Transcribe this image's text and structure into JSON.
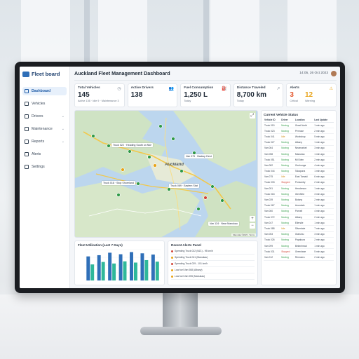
{
  "app": {
    "brand": "Fleet board",
    "title": "Auckland Fleet Management Dashboard",
    "datetime": "14:05, 26 Oct 2023"
  },
  "sidebar": {
    "items": [
      {
        "label": "Dashboard",
        "icon": "dashboard-icon",
        "active": true,
        "chevron": false
      },
      {
        "label": "Vehicles",
        "icon": "truck-icon",
        "active": false,
        "chevron": false
      },
      {
        "label": "Drivers",
        "icon": "user-icon",
        "active": false,
        "chevron": true
      },
      {
        "label": "Maintenance",
        "icon": "wrench-icon",
        "active": false,
        "chevron": true
      },
      {
        "label": "Reports",
        "icon": "report-icon",
        "active": false,
        "chevron": true
      },
      {
        "label": "Alerts",
        "icon": "bell-icon",
        "active": false,
        "chevron": false
      },
      {
        "label": "Settings",
        "icon": "gear-icon",
        "active": false,
        "chevron": false
      }
    ]
  },
  "cards": {
    "vehicles": {
      "label": "Total Vehicles",
      "value": "145",
      "sub": "Active 136 · Idle 9 · Maintenance 3"
    },
    "drivers": {
      "label": "Active Drivers",
      "value": "138"
    },
    "fuel": {
      "label": "Fuel Consumption",
      "value": "1,250 L",
      "sub": "Today"
    },
    "distance": {
      "label": "Distance Traveled",
      "value": "8,700 km",
      "sub": "Today"
    },
    "alerts": {
      "label": "Alerts",
      "critical_value": "3",
      "critical_label": "Critical",
      "warning_value": "12",
      "warning_label": "Warning"
    }
  },
  "map": {
    "city_label": "Auckland",
    "attribution": "Map data ©2023 · Terms",
    "callouts": [
      "Truck 022 · Heading South on NW",
      "Van 075 · Backup Dest",
      "Truck 018 · Stop Shoreland",
      "Truck 089 · Eastern Stat",
      "Van 124 · Near Manukau"
    ]
  },
  "utilization": {
    "title": "Fleet Utilization (Last 7 Days)"
  },
  "recent_alerts": {
    "title": "Recent Alerts Panel",
    "items": [
      {
        "text": "Speeding Truck 022 (NZ1) - 95 km/h",
        "color": "#d2463a"
      },
      {
        "text": "Speeding Truck 041 (Manukau)",
        "color": "#e8a317"
      },
      {
        "text": "Speeding Truck 029 - 101 km/h",
        "color": "#d2463a"
      },
      {
        "text": "Low fuel Van 068 (Albany)",
        "color": "#e8a317"
      },
      {
        "text": "Low fuel Van 055 (Manukau)",
        "color": "#e8a317"
      }
    ]
  },
  "status": {
    "title": "Current Vehicle Status",
    "columns": [
      "Vehicle ID",
      "Driver",
      "Location",
      "Last Update"
    ],
    "rows": [
      [
        "Truck 015",
        "Moving",
        "Great North",
        "1 min ago"
      ],
      [
        "Truck 023",
        "Moving",
        "Penrose",
        "2 min ago"
      ],
      [
        "Truck 041",
        "Idle",
        "Workshop",
        "5 min ago"
      ],
      [
        "Truck 027",
        "Moving",
        "Albany",
        "1 min ago"
      ],
      [
        "Van 064",
        "Moving",
        "Newmarket",
        "3 min ago"
      ],
      [
        "Van 058",
        "Moving",
        "Manukau",
        "1 min ago"
      ],
      [
        "Truck 051",
        "Moving",
        "Mt Eden",
        "2 min ago"
      ],
      [
        "Van 082",
        "Moving",
        "Onehunga",
        "4 min ago"
      ],
      [
        "Truck 044",
        "Moving",
        "Takapuna",
        "1 min ago"
      ],
      [
        "Van 075",
        "Idle",
        "East Tamaki",
        "6 min ago"
      ],
      [
        "Truck 033",
        "Stopped",
        "Ponsonby",
        "2 min ago"
      ],
      [
        "Van 091",
        "Moving",
        "Henderson",
        "1 min ago"
      ],
      [
        "Truck 018",
        "Moving",
        "Glenfield",
        "3 min ago"
      ],
      [
        "Van 039",
        "Moving",
        "Botany",
        "2 min ago"
      ],
      [
        "Truck 067",
        "Moving",
        "Avondale",
        "1 min ago"
      ],
      [
        "Van 060",
        "Moving",
        "Parnell",
        "4 min ago"
      ],
      [
        "Truck 072",
        "Moving",
        "Albany",
        "2 min ago"
      ],
      [
        "Van 047",
        "Moving",
        "Ellerslie",
        "1 min ago"
      ],
      [
        "Truck 088",
        "Idle",
        "Silverdale",
        "7 min ago"
      ],
      [
        "Van 053",
        "Moving",
        "Otahuhu",
        "3 min ago"
      ],
      [
        "Truck 026",
        "Moving",
        "Papakura",
        "2 min ago"
      ],
      [
        "Van 099",
        "Moving",
        "Birkenhead",
        "1 min ago"
      ],
      [
        "Truck 031",
        "Stopped",
        "Greenlane",
        "5 min ago"
      ],
      [
        "Van 012",
        "Moving",
        "Remuera",
        "2 min ago"
      ]
    ]
  },
  "chart_data": {
    "type": "bar",
    "categories": [
      "Mon",
      "Tue",
      "Wed",
      "Thu",
      "Fri",
      "Sat",
      "Sun"
    ],
    "series": [
      {
        "values": [
          78,
          82,
          90,
          85,
          92,
          88,
          84
        ],
        "color": "#2f6fb8"
      },
      {
        "values": [
          52,
          60,
          55,
          62,
          58,
          66,
          61
        ],
        "color": "#2fb89a"
      }
    ],
    "ylim": [
      0,
      100
    ],
    "title": "Fleet Utilization (Last 7 Days)"
  }
}
